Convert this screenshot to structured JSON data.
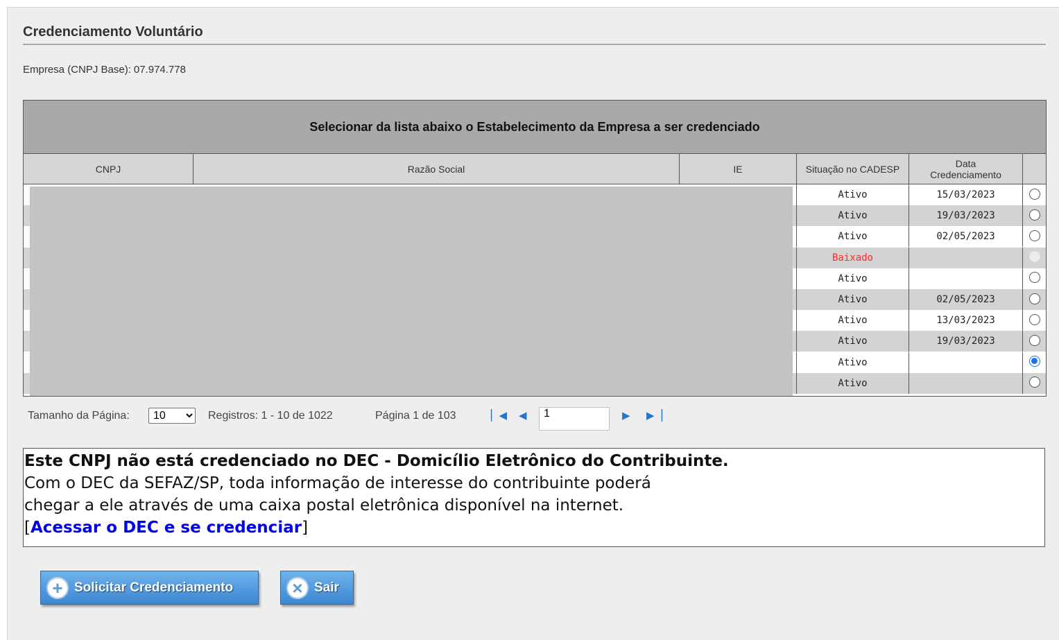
{
  "page": {
    "title": "Credenciamento Voluntário",
    "empresa_label": "Empresa (CNPJ Base):",
    "empresa_value": "07.974.778"
  },
  "grid": {
    "caption": "Selecionar da lista abaixo o Estabelecimento da Empresa a ser credenciado",
    "columns": {
      "cnpj": "CNPJ",
      "razao": "Razão Social",
      "ie": "IE",
      "situacao": "Situação no CADESP",
      "data_line1": "Data",
      "data_line2": "Credenciamento"
    },
    "rows": [
      {
        "situacao": "Ativo",
        "data": "15/03/2023",
        "radio": "unchecked"
      },
      {
        "situacao": "Ativo",
        "data": "19/03/2023",
        "radio": "unchecked"
      },
      {
        "situacao": "Ativo",
        "data": "02/05/2023",
        "radio": "unchecked"
      },
      {
        "situacao": "Baixado",
        "data": "",
        "radio": "disabled"
      },
      {
        "situacao": "Ativo",
        "data": "",
        "radio": "unchecked"
      },
      {
        "situacao": "Ativo",
        "data": "02/05/2023",
        "radio": "unchecked"
      },
      {
        "situacao": "Ativo",
        "data": "13/03/2023",
        "radio": "unchecked"
      },
      {
        "situacao": "Ativo",
        "data": "19/03/2023",
        "radio": "unchecked"
      },
      {
        "situacao": "Ativo",
        "data": "",
        "radio": "checked"
      },
      {
        "situacao": "Ativo",
        "data": "",
        "radio": "unchecked"
      }
    ]
  },
  "pager": {
    "page_size_label": "Tamanho da Página:",
    "page_size_value": "10",
    "registros": "Registros: 1 - 10 de 1022",
    "pagina": "Página 1 de 103",
    "page_input": "1",
    "icons": [
      "first-page-icon",
      "previous-page-icon",
      "next-page-icon",
      "last-page-icon"
    ]
  },
  "notice": {
    "title": "Este CNPJ não está credenciado no DEC - Domicílio Eletrônico do Contribuinte.",
    "line1": "Com o DEC da SEFAZ/SP, toda informação de interesse do contribuinte poderá",
    "line2": "chegar a ele através de uma caixa postal eletrônica disponível na internet.",
    "link_open": "[",
    "link_text": "Acessar o DEC e se credenciar",
    "link_close": "]"
  },
  "buttons": {
    "solicitar": "Solicitar Credenciamento",
    "sair": "Sair"
  },
  "colors": {
    "accent_blue": "#3d87d2",
    "baixado_red": "#ff2a2a",
    "link_blue": "#0000ee"
  }
}
